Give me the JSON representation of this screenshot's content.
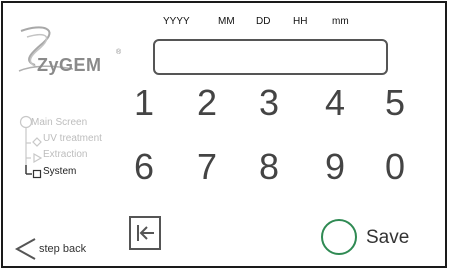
{
  "logo": {
    "text": "ZyGEM",
    "reg": "®"
  },
  "date_fields": [
    "YYYY",
    "MM",
    "DD",
    "HH",
    "mm"
  ],
  "display": {
    "value": ""
  },
  "keypad": {
    "row1": [
      "1",
      "2",
      "3",
      "4",
      "5"
    ],
    "row2": [
      "6",
      "7",
      "8",
      "9",
      "0"
    ]
  },
  "nav": {
    "main_screen": "Main Screen",
    "uv_treatment": "UV treatment",
    "extraction": "Extraction",
    "system": "System"
  },
  "step_back": "step back",
  "save": "Save",
  "colors": {
    "save_ring": "#2f8a53",
    "inactive_nav": "#bdbdbd"
  }
}
